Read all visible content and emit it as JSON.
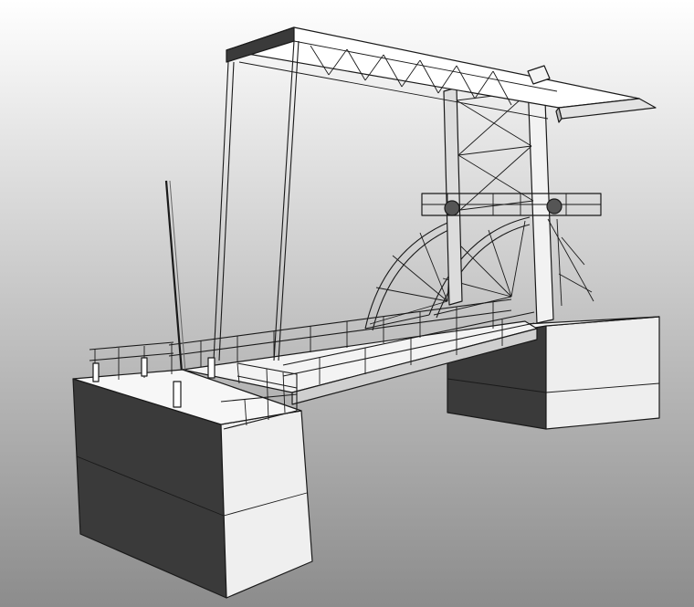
{
  "viewport": {
    "background_top": "#ffffff",
    "background_bottom": "#8c8c8c"
  },
  "model": {
    "subject": "lifting-bridge",
    "face_light": "#f4f4f4",
    "face_mid": "#d9d9d9",
    "face_dark": "#3a3a3a",
    "edge_color": "#1a1a1a"
  }
}
